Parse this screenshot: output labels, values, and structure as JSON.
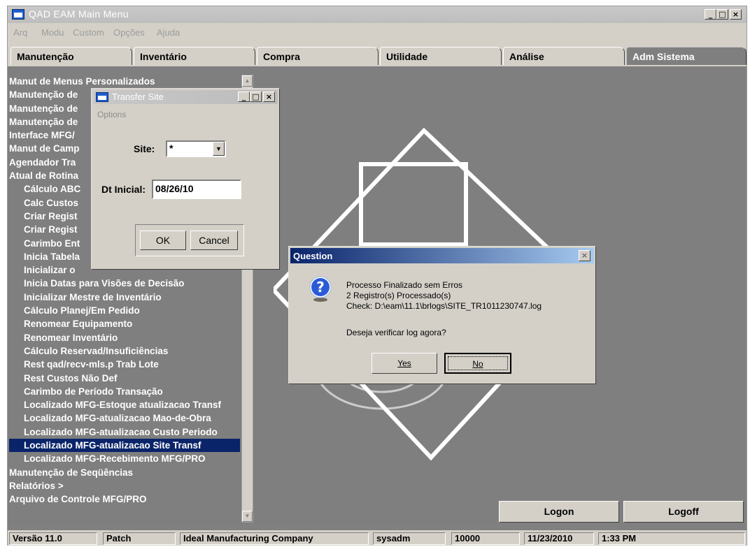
{
  "window": {
    "title": "QAD EAM Main Menu",
    "minimize": "_",
    "maximize": "□",
    "close": "×"
  },
  "menubar": [
    "Arq",
    "Modu",
    "Custom",
    "Opções",
    "Ajuda"
  ],
  "tabs": [
    "Manutenção",
    "Inventário",
    "Compra",
    "Utilidade",
    "Análise",
    "Adm Sistema"
  ],
  "active_tab": "Adm Sistema",
  "menu_items": [
    {
      "label": "Manut de Menus Personalizados",
      "sub": false
    },
    {
      "label": "Manutenção de",
      "sub": false
    },
    {
      "label": "Manutenção de",
      "sub": false
    },
    {
      "label": "Manutenção de",
      "sub": false
    },
    {
      "label": "Interface MFG/",
      "sub": false
    },
    {
      "label": "Manut de Camp",
      "sub": false
    },
    {
      "label": "Agendador Tra",
      "sub": false
    },
    {
      "label": "Atual de Rotina",
      "sub": false
    },
    {
      "label": "Cálculo ABC",
      "sub": true
    },
    {
      "label": "Calc Custos",
      "sub": true
    },
    {
      "label": "Criar Regist",
      "sub": true
    },
    {
      "label": "Criar Regist",
      "sub": true
    },
    {
      "label": "Carimbo Ent",
      "sub": true
    },
    {
      "label": "Inicia Tabela",
      "sub": true
    },
    {
      "label": "Inicializar o",
      "sub": true
    },
    {
      "label": "Inicia Datas para Visões de Decisão",
      "sub": true
    },
    {
      "label": "Inicializar Mestre de Inventário",
      "sub": true
    },
    {
      "label": "Cálculo Planej/Em Pedido",
      "sub": true
    },
    {
      "label": "Renomear Equipamento",
      "sub": true
    },
    {
      "label": "Renomear Inventário",
      "sub": true
    },
    {
      "label": "Cálculo Reservad/Insuficiências",
      "sub": true
    },
    {
      "label": "Rest qad/recv-mls.p Trab Lote",
      "sub": true
    },
    {
      "label": "Rest Custos Não Def",
      "sub": true
    },
    {
      "label": "Carimbo de Período Transação",
      "sub": true
    },
    {
      "label": "Localizado MFG-Estoque atualizacao Transf",
      "sub": true
    },
    {
      "label": "Localizado MFG-atualizacao Mao-de-Obra",
      "sub": true
    },
    {
      "label": "Localizado MFG-atualizacao Custo Periodo",
      "sub": true
    },
    {
      "label": "Localizado MFG-atualizacao Site Transf",
      "sub": true,
      "selected": true
    },
    {
      "label": "Localizado MFG-Recebimento MFG/PRO",
      "sub": true
    },
    {
      "label": "Manutenção de Seqüências",
      "sub": false
    },
    {
      "label": "Relatórios >",
      "sub": false
    },
    {
      "label": "Arquivo de Controle MFG/PRO",
      "sub": false
    }
  ],
  "buttons": {
    "logon": "Logon",
    "logoff": "Logoff"
  },
  "status": [
    "Versão 11.0",
    "Patch",
    "Ideal Manufacturing Company",
    "sysadm",
    "10000",
    "11/23/2010",
    "1:33 PM"
  ],
  "transfer_dialog": {
    "title": "Transfer Site",
    "options_label": "Options",
    "site_label": "Site:",
    "site_value": "*",
    "date_label": "Dt Inicial:",
    "date_value": "08/26/10",
    "ok": "OK",
    "cancel": "Cancel"
  },
  "question_dialog": {
    "title": "Question",
    "lines": [
      "Processo Finalizado sem Erros",
      "2 Registro(s) Processado(s)",
      "Check:  D:\\eam\\11.1\\brlogs\\SITE_TR1011230747.log"
    ],
    "prompt": "Deseja verificar log agora?",
    "yes": "Yes",
    "no": "No"
  },
  "colors": {
    "selection": "#0a246a",
    "background": "#7f7f7f",
    "dialog": "#d4d0c8"
  }
}
